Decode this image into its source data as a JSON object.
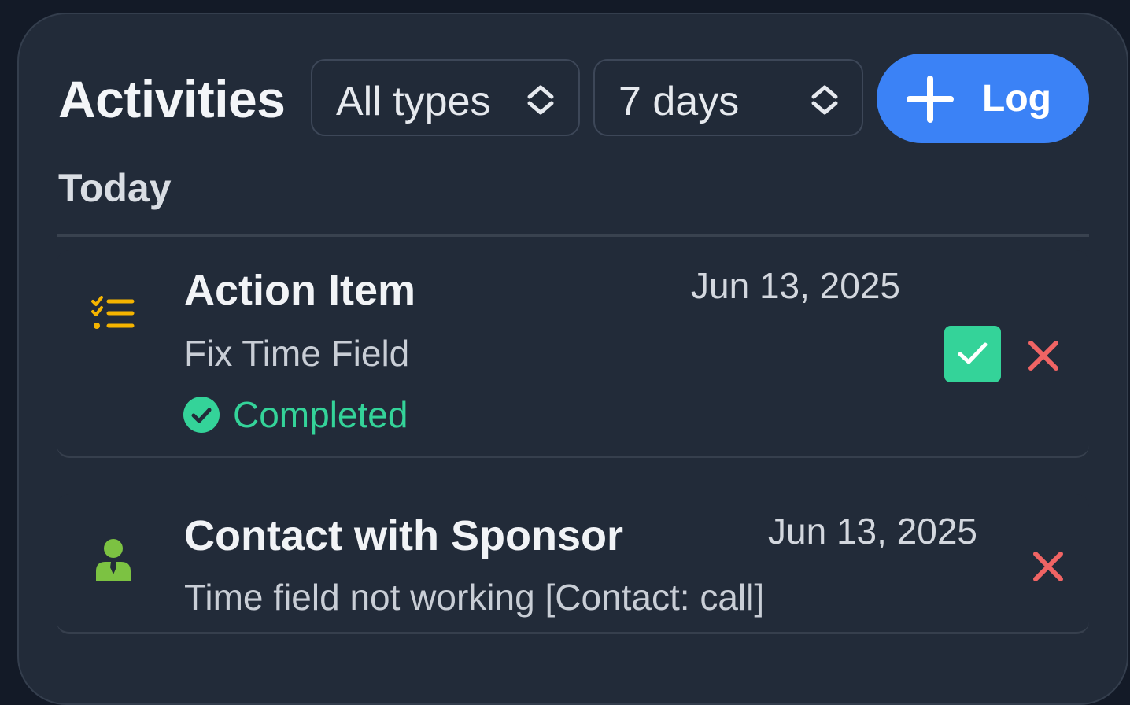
{
  "header": {
    "title": "Activities",
    "type_filter": {
      "value": "All types",
      "icon": "chevron-up-down-icon"
    },
    "range_filter": {
      "value": "7 days",
      "icon": "chevron-up-down-icon"
    },
    "log_button": {
      "label": "Log",
      "icon": "plus-icon"
    }
  },
  "section": {
    "label": "Today"
  },
  "activities": [
    {
      "type": "Action Item",
      "icon": "checklist-icon",
      "date": "Jun 13, 2025",
      "description": "Fix Time Field",
      "status": "Completed",
      "actions": [
        "complete",
        "delete"
      ]
    },
    {
      "type": "Contact with Sponsor",
      "icon": "person-icon",
      "date": "Jun 13, 2025",
      "description": "Time field not working [Contact: call]",
      "actions": [
        "delete"
      ]
    }
  ],
  "colors": {
    "background": "#131a27",
    "panel": "#222b39",
    "accent": "#3b82f6",
    "success": "#34d399",
    "danger": "#f06464",
    "action_item_icon": "#f5b400",
    "contact_icon": "#7cc242"
  }
}
